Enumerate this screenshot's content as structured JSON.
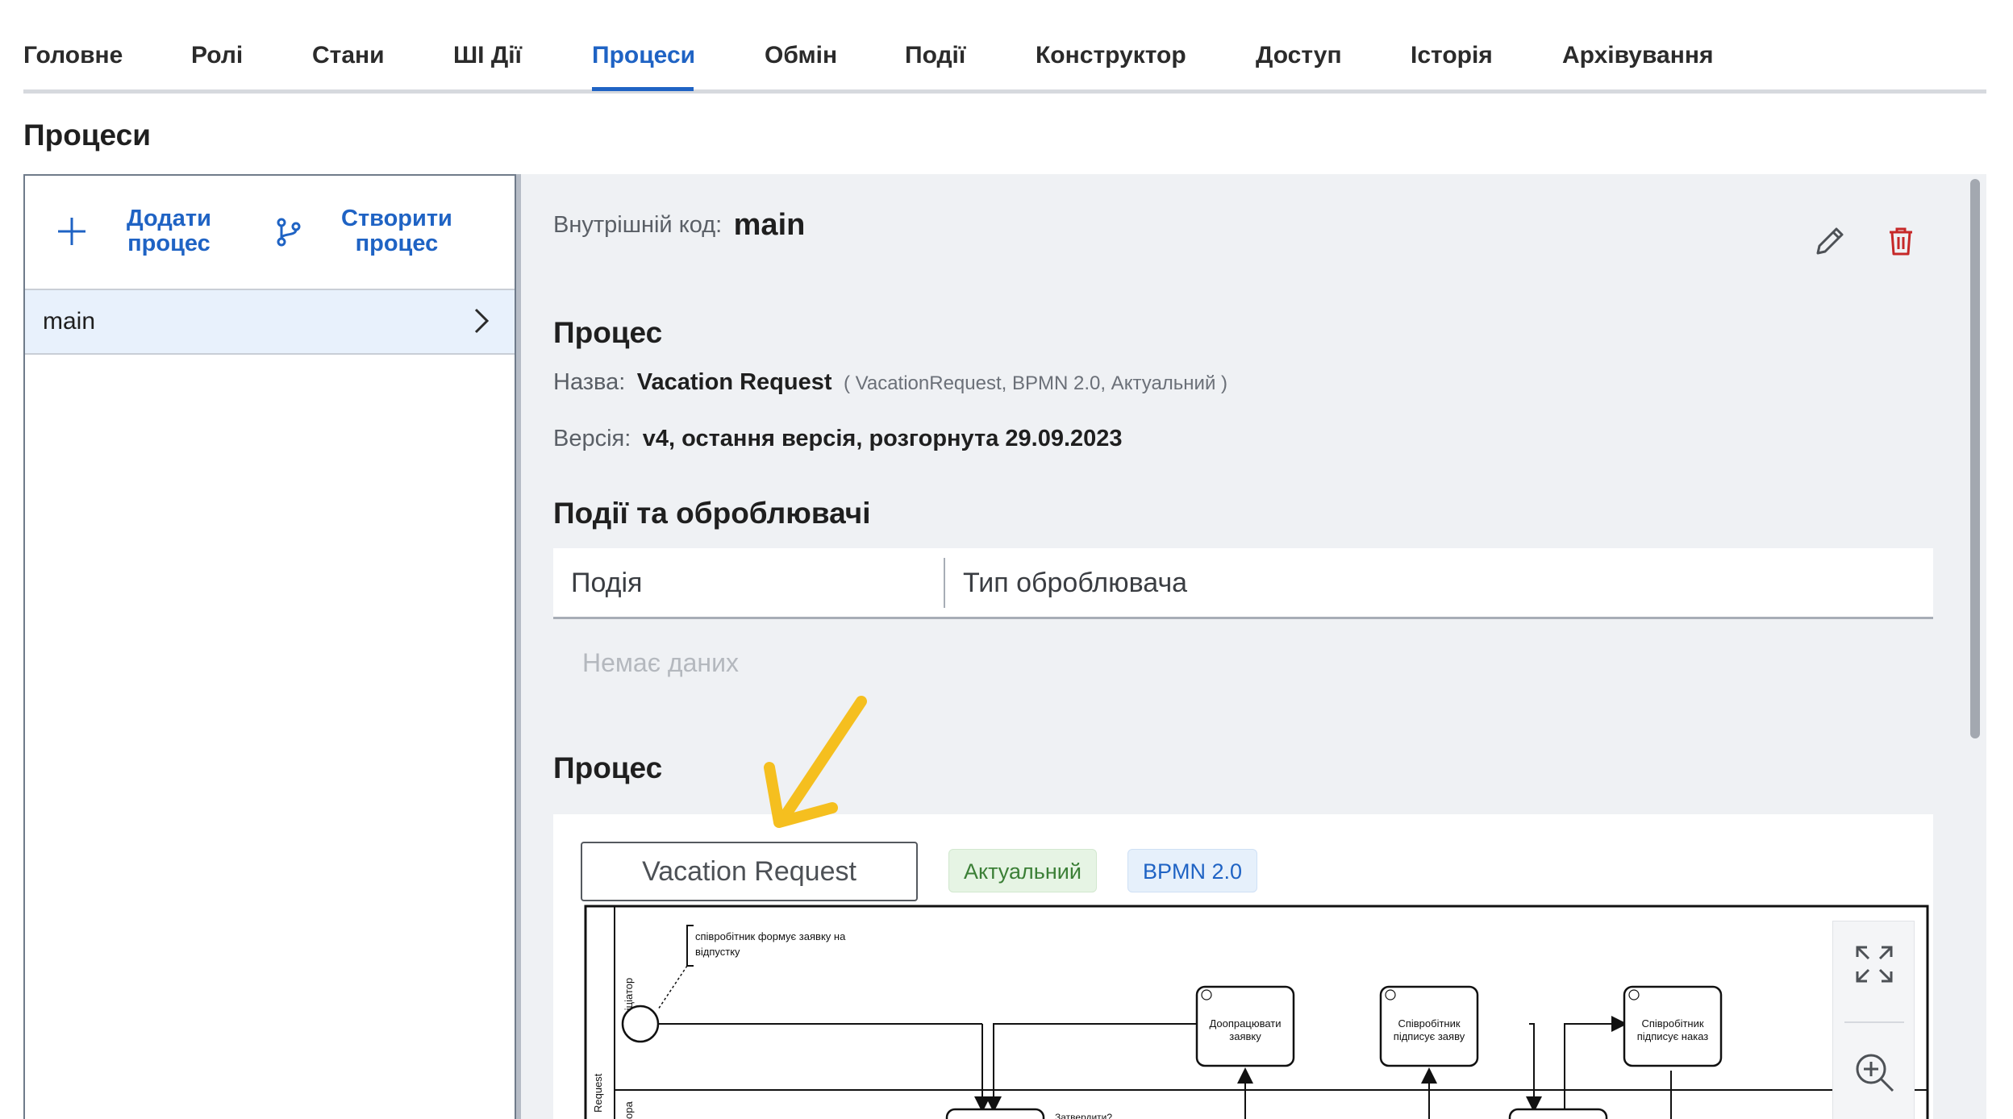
{
  "tabs": [
    {
      "label": "Головне"
    },
    {
      "label": "Ролі"
    },
    {
      "label": "Стани"
    },
    {
      "label": "ШІ Дії"
    },
    {
      "label": "Процеси"
    },
    {
      "label": "Обмін"
    },
    {
      "label": "Події"
    },
    {
      "label": "Конструктор"
    },
    {
      "label": "Доступ"
    },
    {
      "label": "Історія"
    },
    {
      "label": "Архівування"
    }
  ],
  "active_tab": "Процеси",
  "page_title": "Процеси",
  "left": {
    "add_label_1": "Додати",
    "add_label_2": "процес",
    "create_label_1": "Створити",
    "create_label_2": "процес",
    "items": [
      {
        "label": "main"
      }
    ]
  },
  "detail": {
    "code_label": "Внутрішній код:",
    "code_value": "main",
    "process_title": "Процес",
    "name_label": "Назва:",
    "name_value": "Vacation Request",
    "name_meta": "( VacationRequest, BPMN 2.0, Актуальний )",
    "version_label": "Версія:",
    "version_value": "v4, остання версія, розгорнута 29.09.2023",
    "events_title": "Події та оброблювачі",
    "table_headers": [
      "Подія",
      "Тип оброблювача"
    ],
    "no_data": "Немає даних",
    "diagram_title": "Процес"
  },
  "diagram": {
    "name": "Vacation Request",
    "badge_status": "Актуальний",
    "badge_format": "BPMN 2.0",
    "pool_label": "Request",
    "lane1_label": "Ініціатор",
    "lane2_label": "ора",
    "annotation_line1": "співробітник формує заявку на",
    "annotation_line2": "відпустку",
    "task1_line1": "Доопрацювати",
    "task1_line2": "заявку",
    "task2_line1": "Співробітник",
    "task2_line2": "підписує заяву",
    "task3_line1": "Співробітник",
    "task3_line2": "підписує наказ",
    "gateway_label": "Затвердити?"
  },
  "colors": {
    "accent": "#1f63c4",
    "delete": "#c62828",
    "highlight_arrow": "#f5bf1f",
    "status_green": "#3b7f36"
  },
  "icons": {
    "edit": "pencil-icon",
    "delete": "trash-icon",
    "add": "plus-icon",
    "create": "branch-icon",
    "fullscreen": "expand-icon",
    "zoom_in": "zoom-in-icon"
  }
}
